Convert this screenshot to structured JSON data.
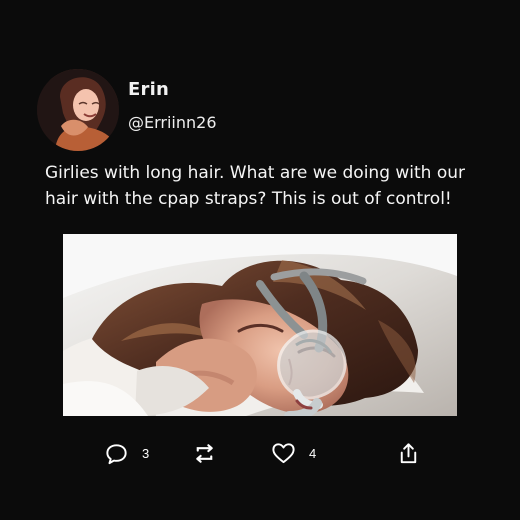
{
  "post": {
    "author": {
      "name": "Erin",
      "handle": "@Erriinn26",
      "avatar_icon": "profile-photo"
    },
    "text": "Girlies with long hair. What are we doing with our hair with the cpap straps? This is out of control!",
    "media": {
      "icon": "photo-sleeping-woman-cpap-mask"
    },
    "actions": {
      "reply": {
        "icon": "reply-icon",
        "count": "3"
      },
      "repost": {
        "icon": "repost-icon"
      },
      "like": {
        "icon": "heart-icon",
        "count": "4"
      },
      "share": {
        "icon": "share-icon"
      }
    }
  },
  "colors": {
    "background": "#0b0b0b",
    "text": "#f5f5f5"
  }
}
